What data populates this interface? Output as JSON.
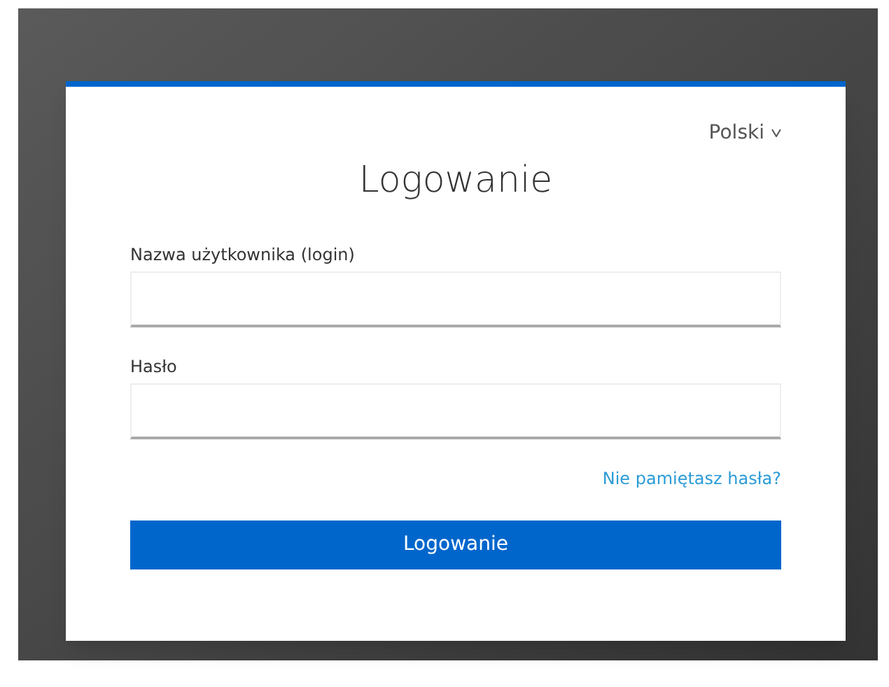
{
  "language": {
    "label": "Polski"
  },
  "title": "Logowanie",
  "fields": [
    {
      "label": "Nazwa użytkownika (login)"
    },
    {
      "label": "Hasło"
    }
  ],
  "forgot_link": "Nie pamiętasz hasła?",
  "submit_button": "Logowanie"
}
